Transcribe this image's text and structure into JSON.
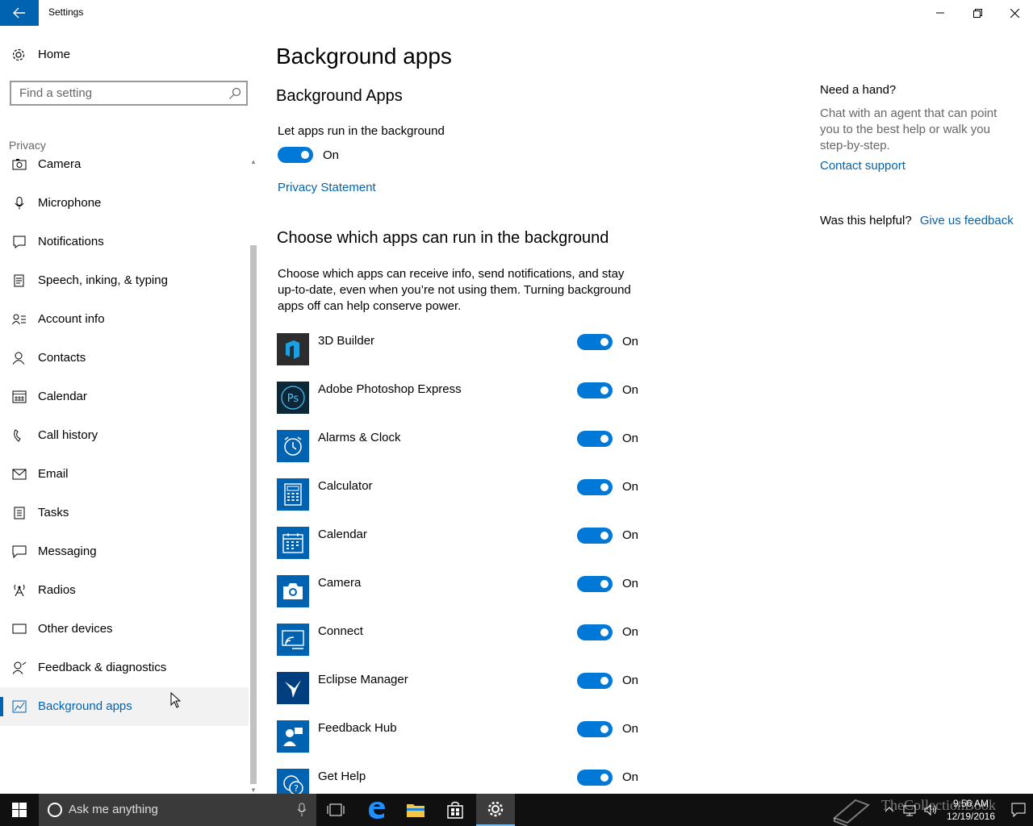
{
  "window": {
    "title": "Settings",
    "back_icon": "back-arrow-icon",
    "controls": [
      "minimize-icon",
      "restore-icon",
      "close-icon"
    ]
  },
  "sidebar": {
    "home_label": "Home",
    "search_placeholder": "Find a setting",
    "section_label": "Privacy",
    "items": [
      {
        "label": "Camera",
        "icon": "camera-icon"
      },
      {
        "label": "Microphone",
        "icon": "microphone-icon"
      },
      {
        "label": "Notifications",
        "icon": "notifications-icon"
      },
      {
        "label": "Speech, inking, & typing",
        "icon": "speech-icon"
      },
      {
        "label": "Account info",
        "icon": "account-info-icon"
      },
      {
        "label": "Contacts",
        "icon": "contacts-icon"
      },
      {
        "label": "Calendar",
        "icon": "calendar-icon"
      },
      {
        "label": "Call history",
        "icon": "call-history-icon"
      },
      {
        "label": "Email",
        "icon": "email-icon"
      },
      {
        "label": "Tasks",
        "icon": "tasks-icon"
      },
      {
        "label": "Messaging",
        "icon": "messaging-icon"
      },
      {
        "label": "Radios",
        "icon": "radios-icon"
      },
      {
        "label": "Other devices",
        "icon": "other-devices-icon"
      },
      {
        "label": "Feedback & diagnostics",
        "icon": "feedback-icon"
      },
      {
        "label": "Background apps",
        "icon": "background-apps-icon",
        "active": true
      }
    ]
  },
  "main": {
    "page_title": "Background apps",
    "section1_title": "Background Apps",
    "master_setting_label": "Let apps run in the background",
    "master_toggle_state": "On",
    "privacy_link": "Privacy Statement",
    "section2_title": "Choose which apps can run in the background",
    "description": "Choose which apps can receive info, send notifications, and stay up-to-date, even when you’re not using them. Turning background apps off can help conserve power.",
    "apps": [
      {
        "name": "3D Builder",
        "state": "On",
        "icon": "3d-builder-icon",
        "color": "#2d2d30"
      },
      {
        "name": "Adobe Photoshop Express",
        "state": "On",
        "icon": "photoshop-express-icon",
        "color": "#0c2838"
      },
      {
        "name": "Alarms & Clock",
        "state": "On",
        "icon": "alarm-clock-icon",
        "color": "#0063b1"
      },
      {
        "name": "Calculator",
        "state": "On",
        "icon": "calculator-icon",
        "color": "#0063b1"
      },
      {
        "name": "Calendar",
        "state": "On",
        "icon": "calendar-app-icon",
        "color": "#0063b1"
      },
      {
        "name": "Camera",
        "state": "On",
        "icon": "camera-app-icon",
        "color": "#0063b1"
      },
      {
        "name": "Connect",
        "state": "On",
        "icon": "connect-icon",
        "color": "#0063b1"
      },
      {
        "name": "Eclipse Manager",
        "state": "On",
        "icon": "eclipse-manager-icon",
        "color": "#003f7f"
      },
      {
        "name": "Feedback Hub",
        "state": "On",
        "icon": "feedback-hub-icon",
        "color": "#0063b1"
      },
      {
        "name": "Get Help",
        "state": "On",
        "icon": "get-help-icon",
        "color": "#0063b1"
      }
    ]
  },
  "help": {
    "title": "Need a hand?",
    "text": "Chat with an agent that can point you to the best help or walk you step-by-step.",
    "contact_link": "Contact support",
    "helpful_label": "Was this helpful?",
    "feedback_link": "Give us feedback"
  },
  "taskbar": {
    "search_placeholder": "Ask me anything",
    "time": "9:56 AM",
    "date": "12/19/2016",
    "watermark": "TheCollectionBook"
  },
  "colors": {
    "accent": "#0078d7",
    "link": "#0063b1"
  }
}
